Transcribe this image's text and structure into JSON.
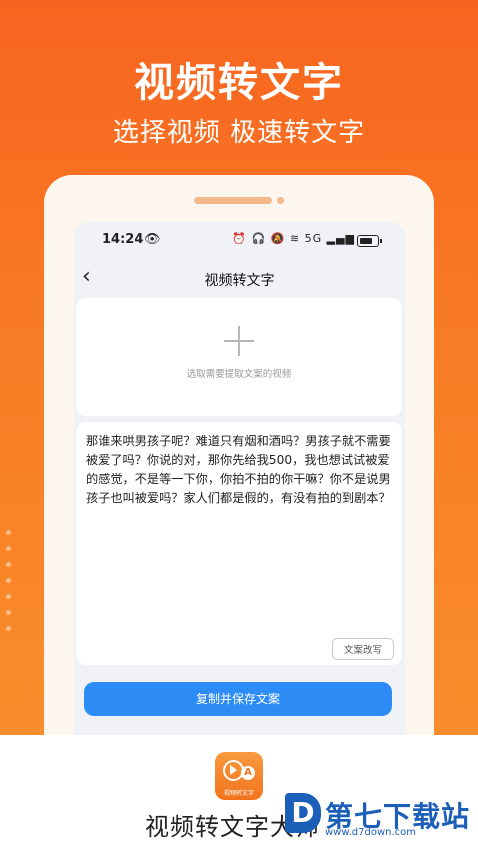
{
  "banner": {
    "title": "视频转文字",
    "subtitle": "选择视频 极速转文字"
  },
  "status_bar": {
    "time": "14:24",
    "network": "5G"
  },
  "nav": {
    "title": "视频转文字"
  },
  "picker": {
    "hint": "选取需要提取文案的视频"
  },
  "transcript": {
    "text": "那谁来哄男孩子呢？难道只有烟和酒吗？男孩子就不需要被爱了吗？你说的对，那你先给我500，我也想试试被爱的感觉，不是等一下你，你拍不拍的你干嘛？你不是说男孩子也叫被爱吗？家人们都是假的，有没有拍的到剧本？",
    "rewrite_label": "文案改写"
  },
  "actions": {
    "copy_save_label": "复制并保存文案"
  },
  "footer": {
    "app_icon_label": "视频转文字",
    "app_name": "视频转文字大师"
  },
  "watermark": {
    "text": "第七下载站",
    "url": "www.d7down.com"
  },
  "colors": {
    "accent_orange": "#f7641f",
    "button_blue": "#2d8cf5",
    "watermark_blue": "#1c5fb8"
  }
}
